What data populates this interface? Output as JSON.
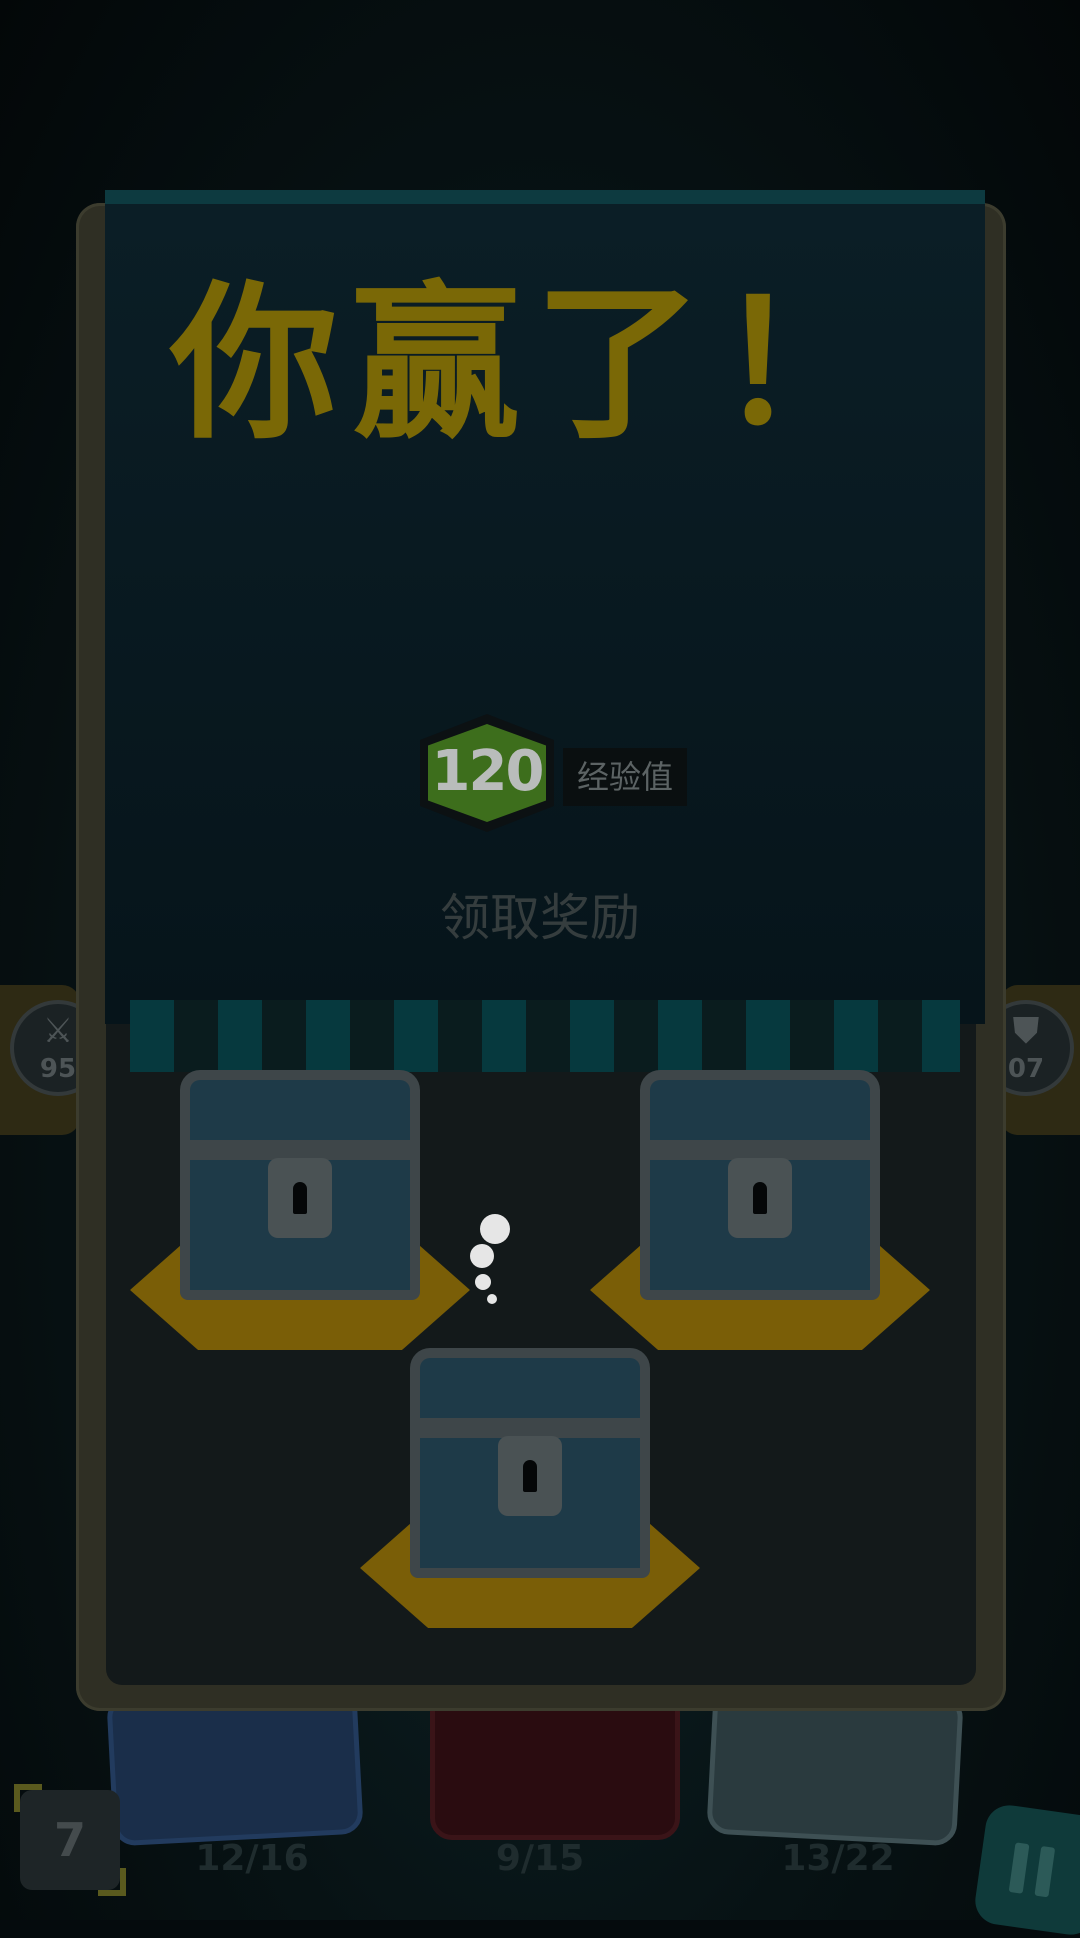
{
  "victory": {
    "title": "你赢了！",
    "xp_value": "120",
    "xp_label": "经验值",
    "collect_label": "领取奖励"
  },
  "side_stats": {
    "left_value": "95",
    "left_icon": "sword-icon",
    "right_value": "07",
    "right_icon": "shield-icon"
  },
  "chests": [
    {
      "name": "chest-1"
    },
    {
      "name": "chest-2"
    },
    {
      "name": "chest-3"
    }
  ],
  "hand": {
    "level": "7",
    "cards": [
      {
        "counter": "12/16"
      },
      {
        "counter": "9/15"
      },
      {
        "counter": "13/22"
      }
    ]
  },
  "colors": {
    "title": "#7a6806",
    "xp_badge": "#3d6e1c",
    "chest_base": "#7a5e07",
    "banner": "#0b1e26"
  }
}
